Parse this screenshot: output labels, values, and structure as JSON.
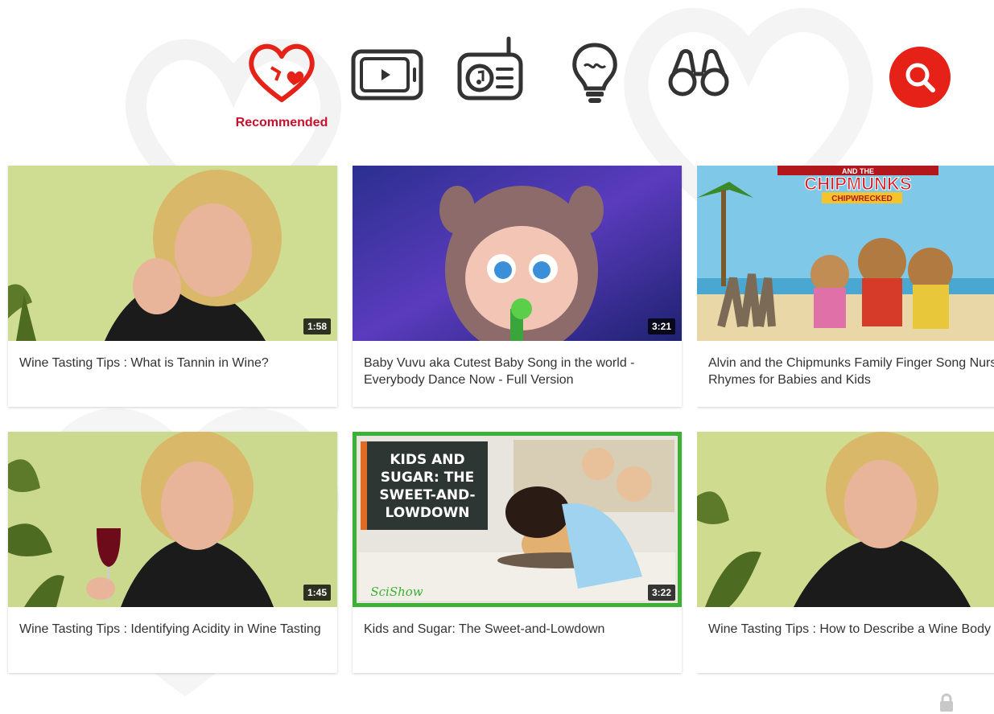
{
  "nav": {
    "items": [
      {
        "id": "recommended",
        "icon": "heart-icon",
        "label": "Recommended",
        "active": true
      },
      {
        "id": "shows",
        "icon": "tv-play-icon",
        "label": "",
        "active": false
      },
      {
        "id": "music",
        "icon": "radio-icon",
        "label": "",
        "active": false
      },
      {
        "id": "learning",
        "icon": "lightbulb-icon",
        "label": "",
        "active": false
      },
      {
        "id": "explore",
        "icon": "binoculars-icon",
        "label": "",
        "active": false
      }
    ],
    "search_icon": "search-icon",
    "accent_color": "#e62117",
    "label_color": "#c8102e"
  },
  "videos": [
    {
      "title": "Wine Tasting Tips : What is Tannin in Wine?",
      "duration": "1:58"
    },
    {
      "title": "Baby Vuvu aka Cutest Baby Song in the world - Everybody Dance Now - Full Version",
      "duration": "3:21"
    },
    {
      "title": "Alvin and the Chipmunks Family Finger Song Nursery Rhymes for Babies and Kids",
      "duration": "",
      "thumb_text": {
        "top": "AND THE",
        "main": "CHIPMUNKS",
        "sub": "CHIPWRECKED"
      }
    },
    {
      "title": "Wine Tasting Tips : Identifying Acidity in Wine Tasting",
      "duration": "1:45"
    },
    {
      "title": "Kids and Sugar: The Sweet-and-Lowdown",
      "duration": "3:22",
      "thumb_text": {
        "line1": "KIDS AND",
        "line2": "SUGAR: THE",
        "line3": "SWEET-AND-",
        "line4": "LOWDOWN",
        "logo": "SciShow"
      }
    },
    {
      "title": "Wine Tasting Tips : How to Describe a Wine Body",
      "duration": ""
    }
  ],
  "footer": {
    "lock_icon": "lock-icon"
  }
}
